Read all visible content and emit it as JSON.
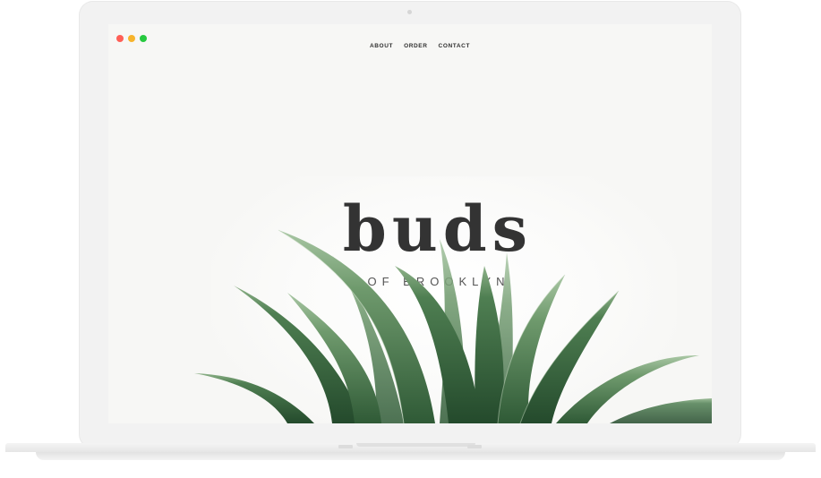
{
  "nav": {
    "items": [
      {
        "label": "ABOUT"
      },
      {
        "label": "ORDER"
      },
      {
        "label": "CONTACT"
      }
    ]
  },
  "hero": {
    "brand": "buds",
    "tagline": "OF BROOKLYN"
  },
  "window": {
    "controls": [
      "close",
      "minimize",
      "maximize"
    ]
  },
  "colors": {
    "background": "#f7f7f5",
    "text": "#333333",
    "plant_light": "#8fb38a",
    "plant_dark": "#2f5a36"
  },
  "icons": [
    "plant-illustration-icon"
  ]
}
